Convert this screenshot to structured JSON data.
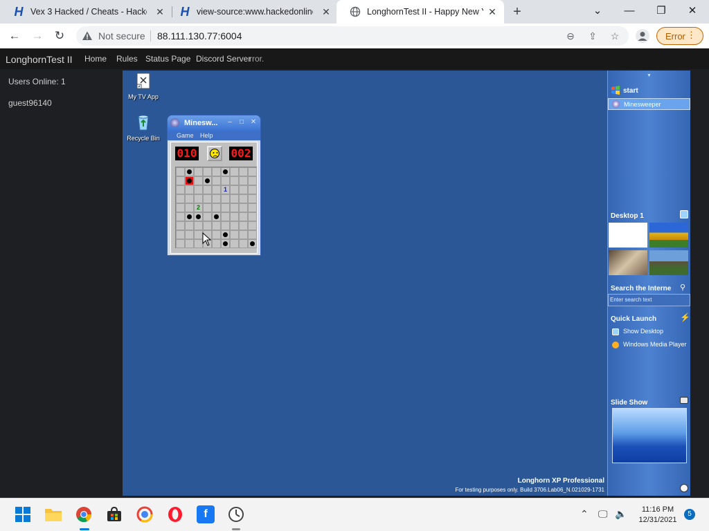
{
  "browser": {
    "tabs": [
      {
        "title": "Vex 3 Hacked / Cheats - Hacked",
        "favicon": "H"
      },
      {
        "title": "view-source:www.hackedonlineg",
        "favicon": "H"
      },
      {
        "title": "LonghornTest II - Happy New Ye",
        "favicon": "globe-icon"
      }
    ],
    "url": "88.111.130.77:6004",
    "security_label": "Not secure",
    "error_button": "Error"
  },
  "site": {
    "brand": "LonghornTest II",
    "nav": [
      "Home",
      "Rules",
      "Status Page",
      "Discord Server"
    ],
    "nav_error": "rror.",
    "users_online": "Users Online: 1",
    "user": "guest96140"
  },
  "desktop": {
    "icons": [
      {
        "label": "My TV App",
        "icon": "tv-app-icon"
      },
      {
        "label": "Recycle Bin",
        "icon": "recycle-bin-icon"
      }
    ],
    "watermark_title": "Longhorn XP Professional",
    "watermark_build": "For testing purposes only. Build 3706.Lab06_N.021029-1731"
  },
  "minesweeper": {
    "title": "Minesw...",
    "menu": [
      "Game",
      "Help"
    ],
    "mines_left": "010",
    "timer": "002",
    "face": "sad",
    "rows": [
      "   .  M  .  .  .  M  .  .  .",
      ".  X  .  M  .  .  .  .  .",
      ".  .  .  .  .  1  .  .  .",
      ".  .  .  .  .  .  .  .  .",
      ".  .  2  .  .  .  .  .  .",
      ".  M  M  .  M  .  .  .  .",
      ".  .  .  .  .  .  .  .  .",
      ".  .  .  .  .  M  .  .  .",
      ".  .  .  .  .  M  .  .  M"
    ]
  },
  "sidebar": {
    "start": "start",
    "taskbar_item": "Minesweeper",
    "desktop_heading": "Desktop 1",
    "search_heading": "Search the Interne",
    "search_placeholder": "Enter search text",
    "quicklaunch_heading": "Quick Launch",
    "quicklaunch_items": [
      "Show Desktop",
      "Windows Media Player"
    ],
    "slideshow_heading": "Slide Show"
  },
  "windows_taskbar": {
    "time": "11:16 PM",
    "date": "12/31/2021",
    "notifications": "5"
  }
}
